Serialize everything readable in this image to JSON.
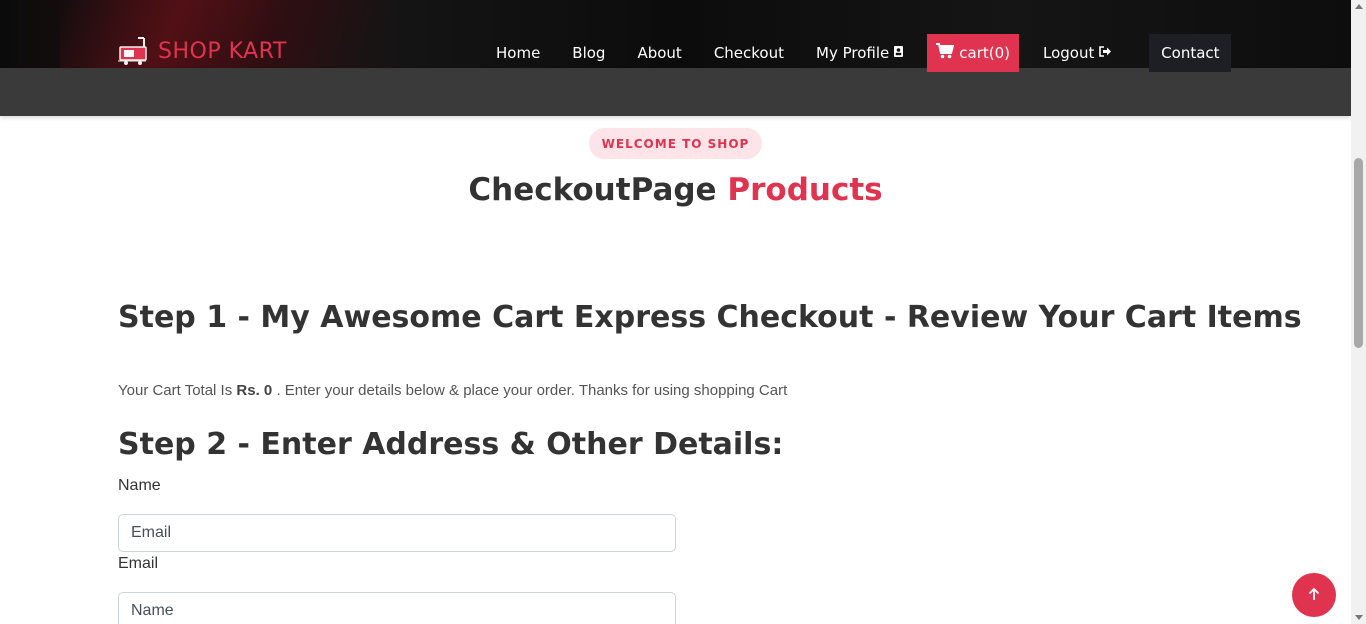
{
  "brand": {
    "name": "SHOP KART",
    "icon": "shopping-cart-logo-icon"
  },
  "nav": {
    "home": "Home",
    "blog": "Blog",
    "about": "About",
    "checkout": "Checkout",
    "profile": "My Profile",
    "profile_icon": "id-card-icon",
    "cart_label": "cart",
    "cart_count": "(0)",
    "cart_icon": "shopping-cart-icon",
    "logout": "Logout",
    "logout_icon": "sign-out-icon",
    "contact": "Contact"
  },
  "hero": {
    "badge": "WELCOME TO SHOP",
    "title_main": "CheckoutPage",
    "title_accent": "Products"
  },
  "checkout": {
    "step1_title": "Step 1 - My Awesome Cart Express Checkout - Review Your Cart Items",
    "total_prefix": "Your Cart Total Is",
    "total_value": "Rs. 0",
    "total_suffix": ". Enter your details below & place your order. Thanks for using shopping Cart",
    "step2_title": "Step 2 - Enter Address & Other Details:",
    "name_label": "Name",
    "name_placeholder": "Email",
    "email_label": "Email",
    "email_placeholder": "Name"
  },
  "colors": {
    "accent": "#e0334f",
    "header_bg": "#0d0d0d",
    "subbar_bg": "#3a3a3a",
    "contact_bg": "#1e1f24",
    "badge_bg": "#fce4e8",
    "text_dark": "#333333"
  },
  "back_to_top_icon": "arrow-up-icon"
}
